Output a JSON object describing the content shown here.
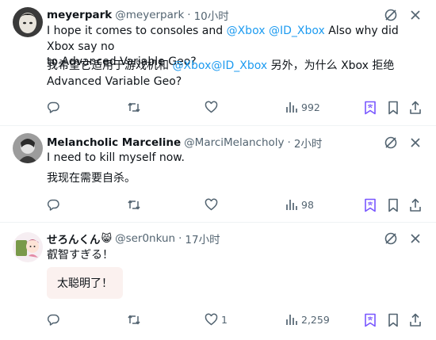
{
  "tweets": [
    {
      "name": "meyerpark",
      "handle": "@meyerpark",
      "sep": "·",
      "time": "10小时",
      "text_line1": {
        "pre": "I hope it comes to consoles and ",
        "m1": "@Xbox",
        "mid": " ",
        "m2": "@ID_Xbox",
        "post": " Also why did Xbox say no"
      },
      "text_line2": "to Advanced Variable Geo?",
      "translation_line1": {
        "pre": "我希望它适用于游戏机和 ",
        "m1": "@Xbox",
        "m2": "@ID_Xbox",
        "post": " 另外，为什么 Xbox 拒绝"
      },
      "translation_line2": "Advanced Variable Geo?",
      "views": "992"
    },
    {
      "name": "Melancholic Marceline",
      "handle": "@MarciMelancholy",
      "sep": "·",
      "time": "2小时",
      "text": "I need to kill myself now.",
      "translation": "我现在需要自杀。",
      "views": "98"
    },
    {
      "name": "せろんくん",
      "emoji": "😸",
      "handle": "@ser0nkun",
      "sep": "·",
      "time": "17小时",
      "text": "叡智すぎる！",
      "translation": "太聪明了！",
      "likes": "1",
      "views": "2,259"
    }
  ],
  "colors": {
    "accent": "#1d9bf0",
    "secondary_text": "#536471",
    "translate_icon": "#7856ff"
  },
  "icons": [
    "edit-grok-icon",
    "close-icon",
    "reply-icon",
    "retweet-icon",
    "like-icon",
    "views-icon",
    "translate-icon",
    "bookmark-icon",
    "share-icon"
  ]
}
